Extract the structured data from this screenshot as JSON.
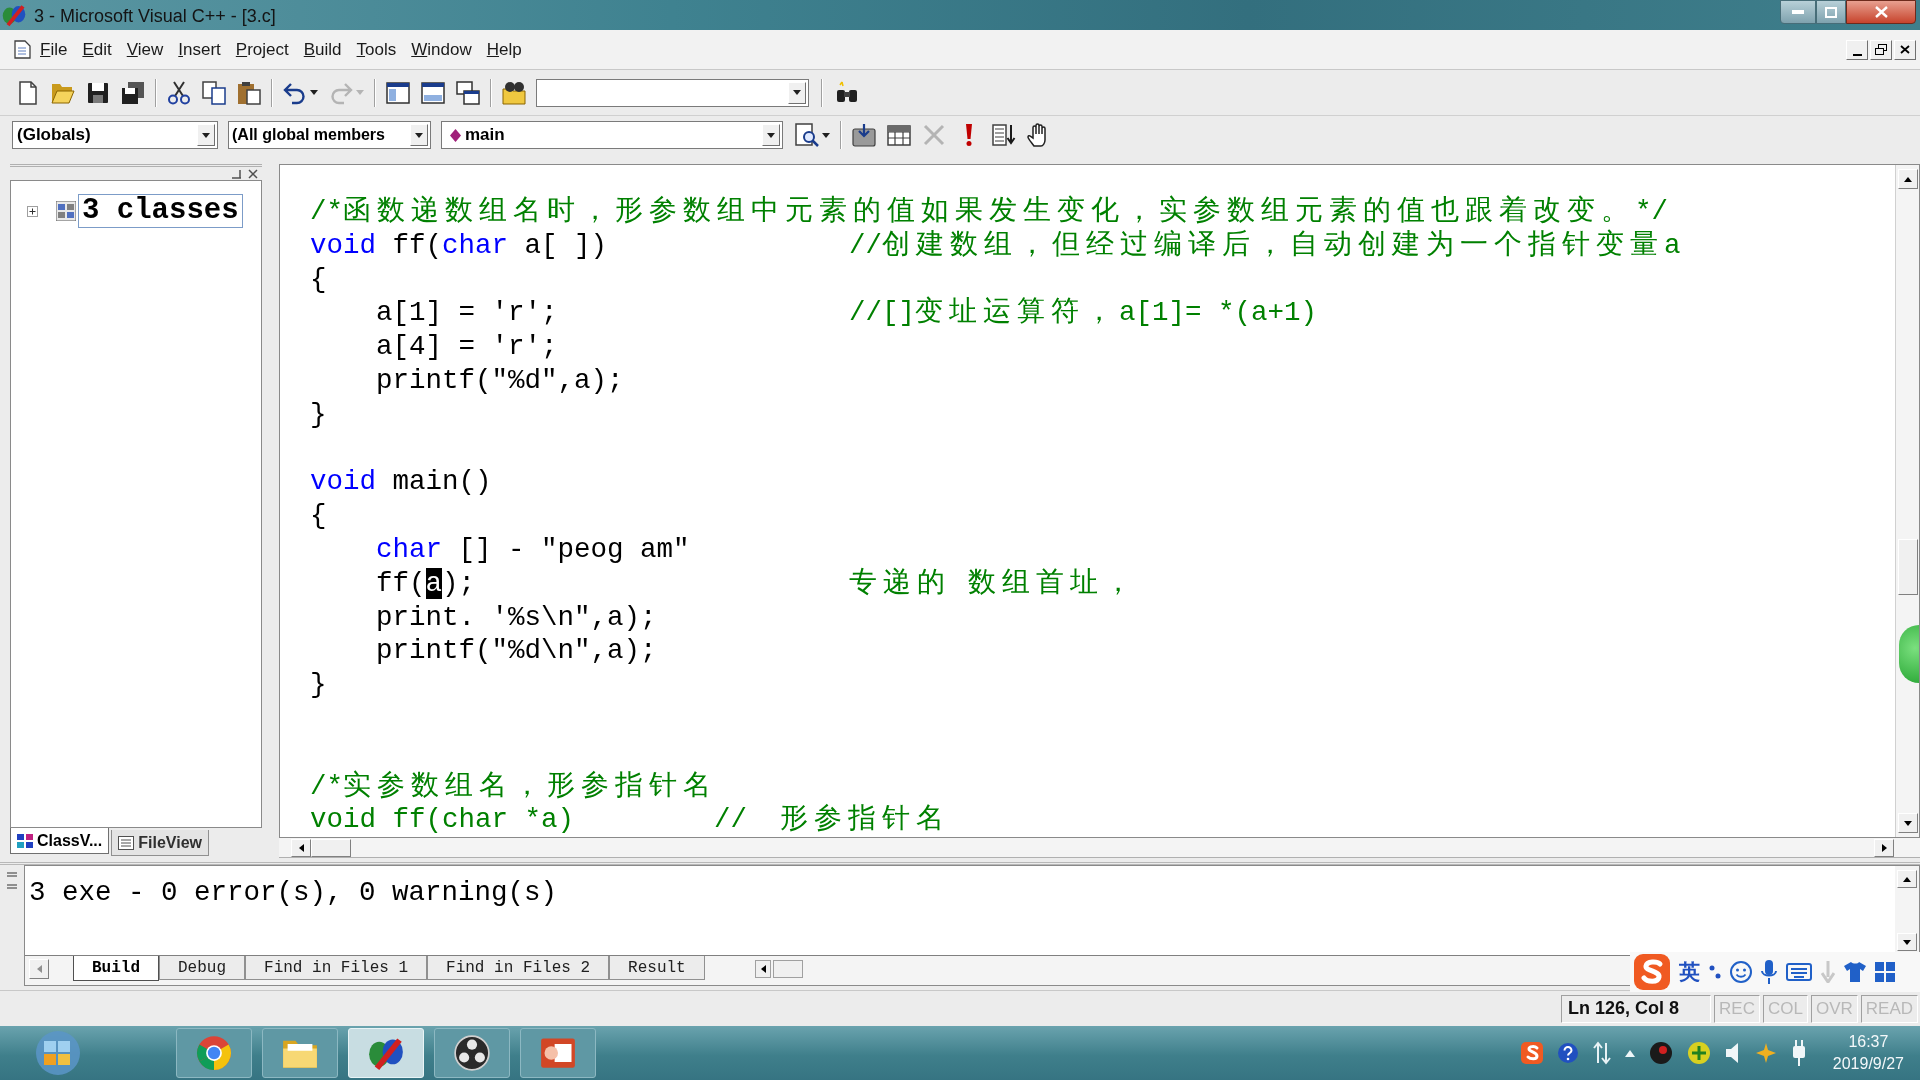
{
  "window": {
    "title": "3 - Microsoft Visual C++ - [3.c]"
  },
  "menu_bar": {
    "items": [
      "File",
      "Edit",
      "View",
      "Insert",
      "Project",
      "Build",
      "Tools",
      "Window",
      "Help"
    ]
  },
  "standard_toolbar": {
    "groups": [
      [
        {
          "kind": "new",
          "disabled": false
        },
        {
          "kind": "open",
          "disabled": false
        },
        {
          "kind": "save",
          "disabled": false
        },
        {
          "kind": "save_all",
          "disabled": false
        }
      ],
      [
        {
          "kind": "cut",
          "disabled": false
        },
        {
          "kind": "copy",
          "disabled": false
        },
        {
          "kind": "paste",
          "disabled": false
        }
      ],
      [
        {
          "kind": "undo",
          "disabled": false
        },
        {
          "kind": "redo",
          "disabled": true
        }
      ],
      [
        {
          "kind": "workspace",
          "disabled": false
        },
        {
          "kind": "output",
          "disabled": false
        },
        {
          "kind": "windows",
          "disabled": false
        }
      ],
      [
        {
          "kind": "find_in_files",
          "disabled": false
        }
      ]
    ]
  },
  "wizard_bar": {
    "class_combo": "(Globals)",
    "filter_combo": "(All global members",
    "member_combo": "main"
  },
  "build_toolbar": {
    "groups": [
      [
        {
          "kind": "wizard_action",
          "disabled": false
        }
      ],
      [
        {
          "kind": "compile",
          "disabled": false
        },
        {
          "kind": "build",
          "disabled": false
        },
        {
          "kind": "stop",
          "disabled": true
        },
        {
          "kind": "execute",
          "disabled": false
        },
        {
          "kind": "go",
          "disabled": false
        },
        {
          "kind": "breakpoint",
          "disabled": false
        }
      ]
    ]
  },
  "workspace": {
    "tree": [
      {
        "label": "3 classes",
        "expanded": false,
        "selected": true
      }
    ],
    "tabs": [
      {
        "label": "ClassV...",
        "selected": true
      },
      {
        "label": "FileView",
        "selected": false
      }
    ]
  },
  "editor": {
    "lines": [
      {
        "kind": "code",
        "tokens": [
          {
            "kind": "comment",
            "text": "/*函数递数组名时，形参数组中元素的值如果发生变化，实参数组元素的值也跟着改变。*/"
          }
        ]
      },
      {
        "kind": "annotated",
        "tokens": [
          {
            "kind": "keyword",
            "text": "void"
          },
          {
            "kind": "plain",
            "text": " ff("
          },
          {
            "kind": "keyword",
            "text": "char"
          },
          {
            "kind": "plain",
            "text": " a[ ])"
          }
        ],
        "note": "//创建数组，但经过编译后，自动创建为一个指针变量a"
      },
      {
        "kind": "code",
        "tokens": [
          {
            "kind": "plain",
            "text": "{"
          }
        ]
      },
      {
        "kind": "block",
        "children": [
          {
            "kind": "annotated",
            "tokens": [
              {
                "kind": "plain",
                "text": "a[1] = 'r';"
              }
            ],
            "note": "//[]变址运算符，a[1]= *(a+1)"
          },
          {
            "kind": "code",
            "tokens": [
              {
                "kind": "plain",
                "text": "a[4] = 'r';"
              }
            ]
          },
          {
            "kind": "code",
            "tokens": [
              {
                "kind": "plain",
                "text": "printf(\"%d\",a);"
              }
            ]
          }
        ]
      },
      {
        "kind": "code",
        "tokens": [
          {
            "kind": "plain",
            "text": "}"
          }
        ]
      },
      {
        "kind": "blank"
      },
      {
        "kind": "code",
        "tokens": [
          {
            "kind": "keyword",
            "text": "void"
          },
          {
            "kind": "plain",
            "text": " main()"
          }
        ]
      },
      {
        "kind": "code",
        "tokens": [
          {
            "kind": "plain",
            "text": "{"
          }
        ]
      },
      {
        "kind": "block",
        "children": [
          {
            "kind": "code",
            "tokens": [
              {
                "kind": "keyword",
                "text": "char"
              },
              {
                "kind": "plain",
                "text": " [] - \"peog am\""
              }
            ]
          },
          {
            "kind": "annotated",
            "tokens": [
              {
                "kind": "plain",
                "text": "ff("
              },
              {
                "kind": "selection",
                "text": "a"
              },
              {
                "kind": "plain",
                "text": ");"
              }
            ],
            "note": "专递的 数组首址，"
          },
          {
            "kind": "code",
            "tokens": [
              {
                "kind": "plain",
                "text": "print. '%s\\n\",a);"
              }
            ]
          },
          {
            "kind": "code",
            "tokens": [
              {
                "kind": "plain",
                "text": "printf(\"%d\\n\",a);"
              }
            ]
          }
        ]
      },
      {
        "kind": "code",
        "tokens": [
          {
            "kind": "plain",
            "text": "}"
          }
        ]
      },
      {
        "kind": "blank"
      },
      {
        "kind": "blank"
      },
      {
        "kind": "code",
        "tokens": [
          {
            "kind": "comment",
            "text": "/*实参数组名，形参指针名"
          }
        ]
      },
      {
        "kind": "commented",
        "tokens": [
          {
            "kind": "comment",
            "text": "void ff(char *a)"
          }
        ],
        "note": "//  形参指针名"
      }
    ]
  },
  "output": {
    "text": "3 exe - 0 error(s), 0 warning(s)",
    "tabs": [
      {
        "label": "Build",
        "selected": true
      },
      {
        "label": "Debug",
        "selected": false
      },
      {
        "label": "Find in Files 1",
        "selected": false
      },
      {
        "label": "Find in Files 2",
        "selected": false
      },
      {
        "label": "Result",
        "selected": false
      }
    ]
  },
  "ime_bar": {
    "mode": "英"
  },
  "status_bar": {
    "position": "Ln 126, Col 8",
    "indicators": [
      {
        "label": "REC",
        "on": false
      },
      {
        "label": "COL",
        "on": false
      },
      {
        "label": "OVR",
        "on": false
      },
      {
        "label": "READ",
        "on": false
      }
    ]
  },
  "taskbar": {
    "apps": [
      {
        "kind": "browser",
        "selected": false
      },
      {
        "kind": "files",
        "selected": false
      },
      {
        "kind": "ide",
        "selected": true
      },
      {
        "kind": "recorder",
        "selected": false
      },
      {
        "kind": "slides",
        "selected": false
      }
    ],
    "clock": {
      "time": "16:37",
      "date": "2019/9/27"
    }
  }
}
